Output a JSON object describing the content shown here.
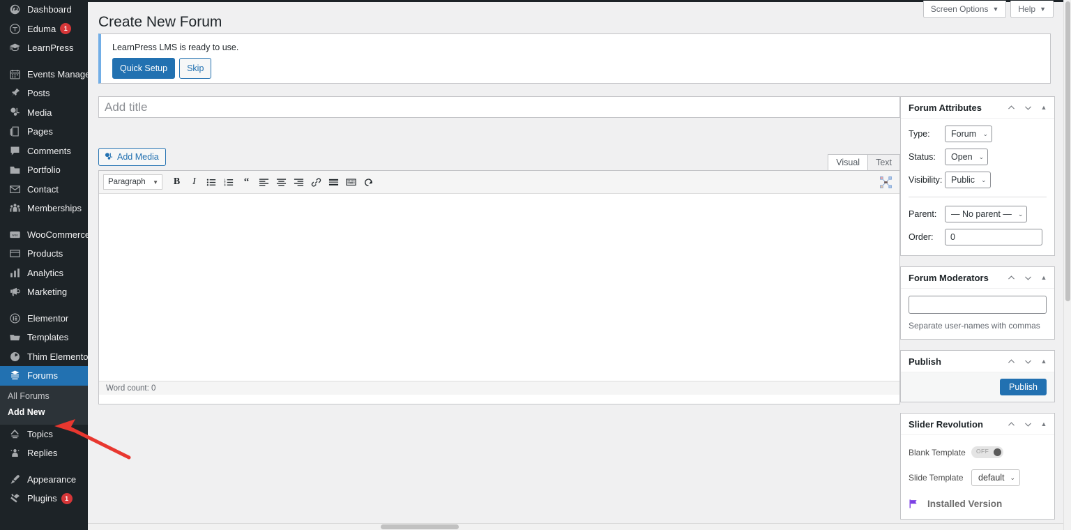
{
  "sidebar": {
    "items": [
      {
        "label": "Dashboard",
        "icon": "dashboard-icon",
        "badge": null,
        "sep_after": false
      },
      {
        "label": "Eduma",
        "icon": "eduma-icon",
        "badge": "1",
        "sep_after": false
      },
      {
        "label": "LearnPress",
        "icon": "learnpress-icon",
        "badge": null,
        "sep_after": true
      },
      {
        "label": "Events Manager",
        "icon": "calendar-icon",
        "badge": null,
        "sep_after": false
      },
      {
        "label": "Posts",
        "icon": "pin-icon",
        "badge": null,
        "sep_after": false
      },
      {
        "label": "Media",
        "icon": "media-icon",
        "badge": null,
        "sep_after": false
      },
      {
        "label": "Pages",
        "icon": "pages-icon",
        "badge": null,
        "sep_after": false
      },
      {
        "label": "Comments",
        "icon": "comment-icon",
        "badge": null,
        "sep_after": false
      },
      {
        "label": "Portfolio",
        "icon": "portfolio-icon",
        "badge": null,
        "sep_after": false
      },
      {
        "label": "Contact",
        "icon": "envelope-icon",
        "badge": null,
        "sep_after": false
      },
      {
        "label": "Memberships",
        "icon": "groups-icon",
        "badge": null,
        "sep_after": true
      },
      {
        "label": "WooCommerce",
        "icon": "woocommerce-icon",
        "badge": null,
        "sep_after": false
      },
      {
        "label": "Products",
        "icon": "products-icon",
        "badge": null,
        "sep_after": false
      },
      {
        "label": "Analytics",
        "icon": "chart-bar-icon",
        "badge": null,
        "sep_after": false
      },
      {
        "label": "Marketing",
        "icon": "megaphone-icon",
        "badge": null,
        "sep_after": true
      },
      {
        "label": "Elementor",
        "icon": "elementor-icon",
        "badge": null,
        "sep_after": false
      },
      {
        "label": "Templates",
        "icon": "folder-icon",
        "badge": null,
        "sep_after": false
      },
      {
        "label": "Thim Elementor",
        "icon": "thim-icon",
        "badge": null,
        "sep_after": false
      }
    ],
    "current_item": {
      "label": "Forums",
      "icon": "forums-icon"
    },
    "submenu": [
      {
        "label": "All Forums",
        "current": false
      },
      {
        "label": "Add New",
        "current": true
      }
    ],
    "items_after": [
      {
        "label": "Topics",
        "icon": "topics-icon",
        "badge": null,
        "sep_after": false
      },
      {
        "label": "Replies",
        "icon": "replies-icon",
        "badge": null,
        "sep_after": true
      },
      {
        "label": "Appearance",
        "icon": "appearance-icon",
        "badge": null,
        "sep_after": false
      },
      {
        "label": "Plugins",
        "icon": "plugins-icon",
        "badge": "1",
        "sep_after": false
      }
    ]
  },
  "screen_meta": {
    "screen_options": "Screen Options",
    "help": "Help",
    "caret": "▼"
  },
  "page": {
    "title": "Create New Forum"
  },
  "notice": {
    "text": "LearnPress LMS is ready to use.",
    "primary_button": "Quick Setup",
    "secondary_button": "Skip",
    "accent_color": "#72aee6"
  },
  "title_field": {
    "placeholder": "Add title",
    "value": ""
  },
  "editor": {
    "add_media_label": "Add Media",
    "tab_visual": "Visual",
    "tab_text": "Text",
    "active_tab": "Visual",
    "format_select": "Paragraph",
    "format_caret": "▼",
    "status_text": "Word count: 0",
    "content": "",
    "toolbar_buttons": [
      {
        "name": "bold-icon",
        "glyph": "B"
      },
      {
        "name": "italic-icon",
        "glyph": "I"
      },
      {
        "name": "bulleted-list-icon",
        "glyph": ""
      },
      {
        "name": "numbered-list-icon",
        "glyph": ""
      },
      {
        "name": "blockquote-icon",
        "glyph": "❝"
      },
      {
        "name": "align-left-icon",
        "glyph": ""
      },
      {
        "name": "align-center-icon",
        "glyph": ""
      },
      {
        "name": "align-right-icon",
        "glyph": ""
      },
      {
        "name": "insert-link-icon",
        "glyph": ""
      },
      {
        "name": "read-more-icon",
        "glyph": ""
      },
      {
        "name": "toolbar-toggle-icon",
        "glyph": ""
      },
      {
        "name": "undo-icon",
        "glyph": ""
      }
    ],
    "fullscreen_icon": "distraction-free-icon"
  },
  "forum_attributes": {
    "title": "Forum Attributes",
    "type_label": "Type:",
    "type_value": "Forum",
    "status_label": "Status:",
    "status_value": "Open",
    "visibility_label": "Visibility:",
    "visibility_value": "Public",
    "parent_label": "Parent:",
    "parent_value": "— No parent —",
    "order_label": "Order:",
    "order_value": "0",
    "caret": "⌄"
  },
  "forum_moderators": {
    "title": "Forum Moderators",
    "input_value": "",
    "hint": "Separate user-names with commas"
  },
  "publish": {
    "title": "Publish",
    "button": "Publish",
    "button_color": "#2271b1"
  },
  "slider_revolution": {
    "title": "Slider Revolution",
    "blank_template_label": "Blank Template",
    "blank_template_state": "OFF",
    "slide_template_label": "Slide Template",
    "slide_template_value": "default",
    "installed_version_label": "Installed Version",
    "flag_color": "#7b3fe4"
  },
  "annotation": {
    "arrow_color": "#e8372f",
    "points_to": "Add New"
  }
}
